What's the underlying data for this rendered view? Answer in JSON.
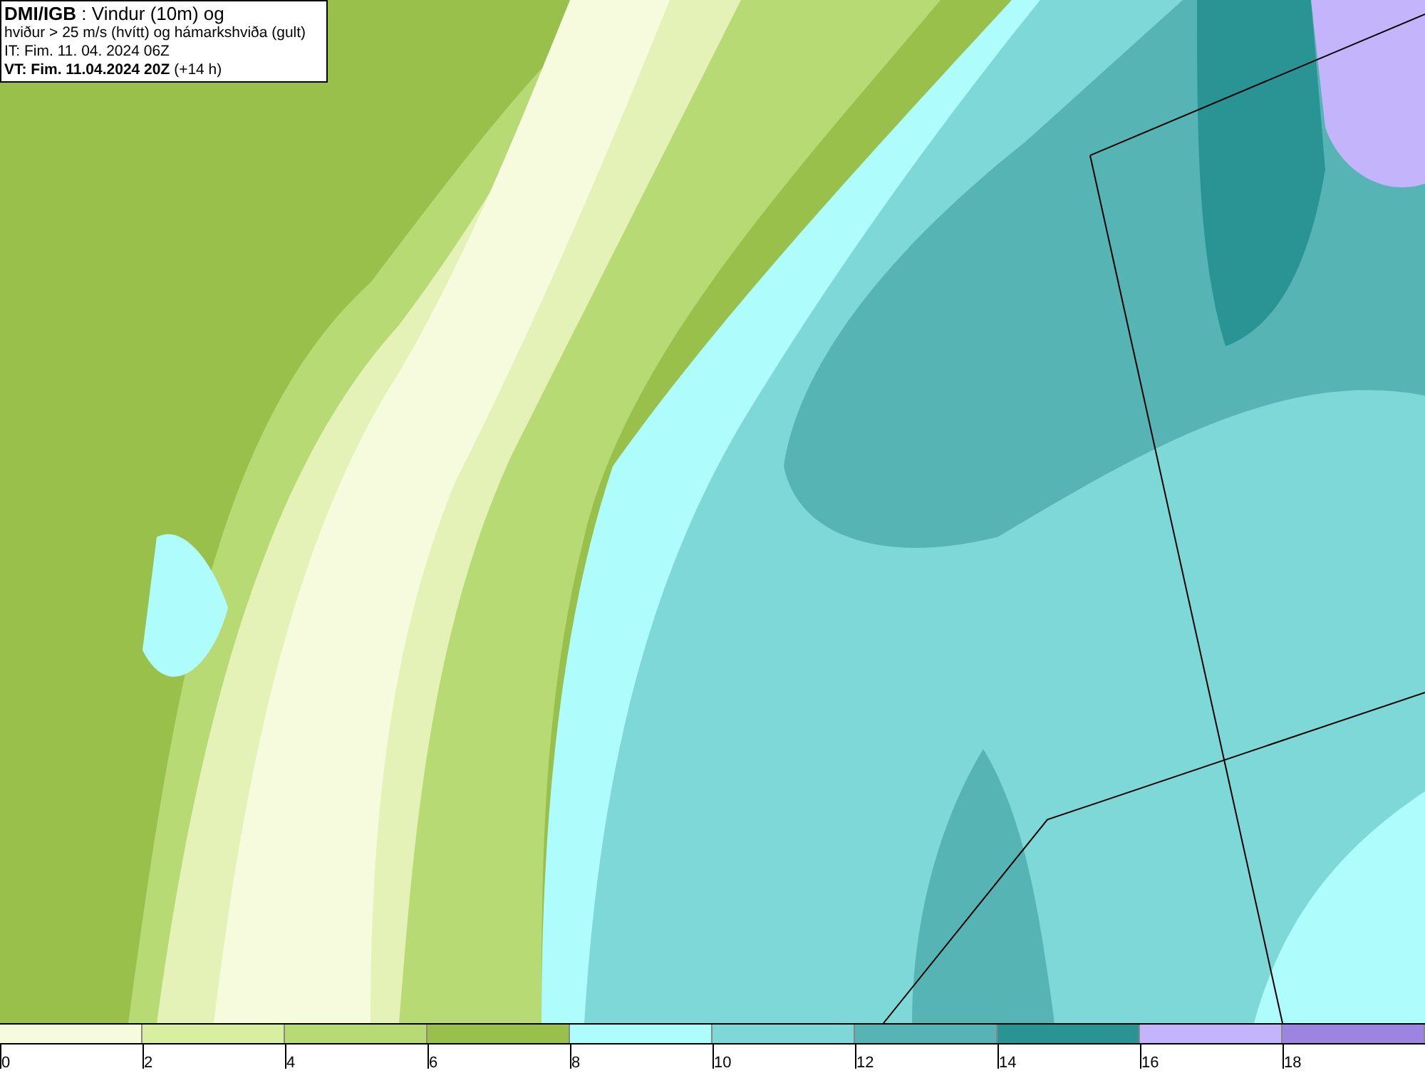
{
  "title_box": {
    "lines": [
      "**DMI/IGB** : Vindur (10m) og",
      "hviður > 25 m/s (hvítt) og hámarkshviða (gult)",
      "IT: Fim. 11. 04. 2024 06Z",
      "**VT: Fim. 11.04.2024 20Z** (+14 h)"
    ]
  },
  "legend": {
    "bins": [
      {
        "color": "#f5fbdc"
      },
      {
        "color": "#d8eea0"
      },
      {
        "color": "#b8da74"
      },
      {
        "color": "#98c04a"
      },
      {
        "color": "#aefcfc"
      },
      {
        "color": "#7fd8d8"
      },
      {
        "color": "#56b4b4"
      },
      {
        "color": "#2a9494"
      },
      {
        "color": "#c4b4fc"
      },
      {
        "color": "#9c84e0"
      }
    ],
    "ticks": [
      "0",
      "2",
      "4",
      "6",
      "8",
      "10",
      "12",
      "14",
      "16",
      "18"
    ]
  }
}
